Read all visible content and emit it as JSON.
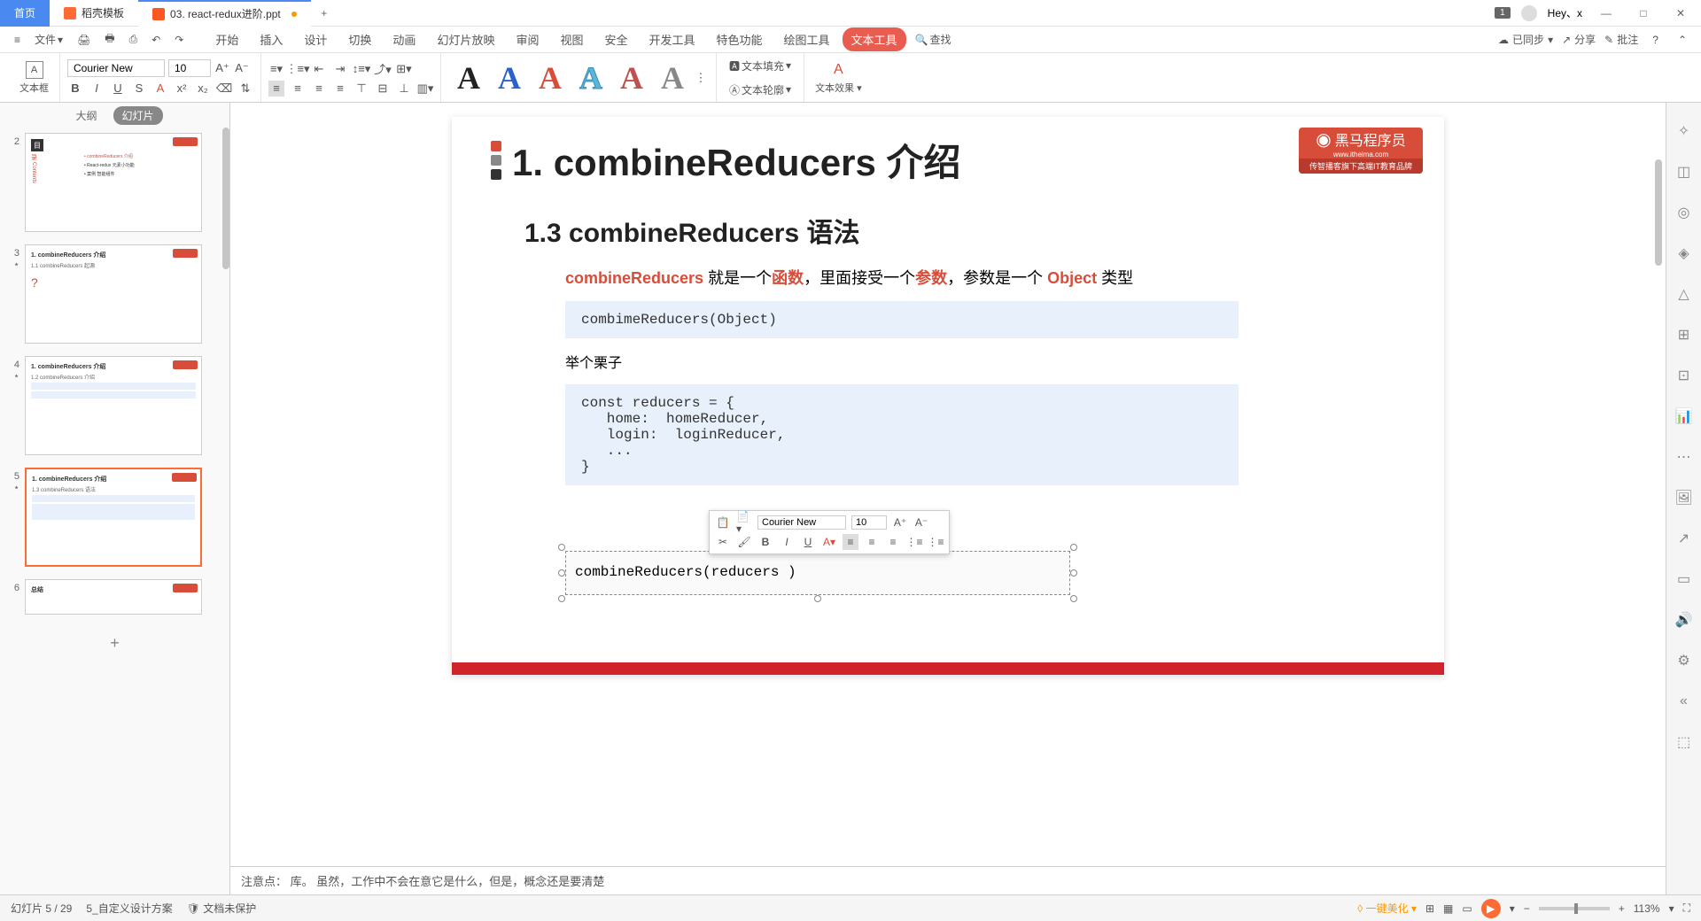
{
  "titlebar": {
    "home": "首页",
    "docer": "稻壳模板",
    "filename": "03. react-redux进阶.ppt",
    "badge": "1",
    "user": "Hey、x"
  },
  "menu": {
    "file": "文件",
    "tabs": [
      "开始",
      "插入",
      "设计",
      "切换",
      "动画",
      "幻灯片放映",
      "审阅",
      "视图",
      "安全",
      "开发工具",
      "特色功能",
      "绘图工具",
      "文本工具"
    ],
    "search": "查找",
    "sync": "已同步",
    "share": "分享",
    "comment": "批注"
  },
  "ribbon": {
    "textbox": "文本框",
    "font": "Courier New",
    "size": "10",
    "textFill": "文本填充",
    "textOutline": "文本轮廓",
    "textEffects": "文本效果"
  },
  "thumbs": {
    "outline": "大纲",
    "slides": "幻灯片",
    "items": [
      {
        "num": "2"
      },
      {
        "num": "3"
      },
      {
        "num": "4"
      },
      {
        "num": "5"
      },
      {
        "num": "6"
      }
    ]
  },
  "slide": {
    "h1": "1. combineReducers 介绍",
    "h2": "1.3 combineReducers 语法",
    "logo": "黑马程序员",
    "logo_url": "www.itheima.com",
    "logo_sub": "传智播客旗下高端IT教育品牌",
    "t1a": "combineReducers",
    "t1b": " 就是一个",
    "t1c": "函数",
    "t1d": "，里面接受一个",
    "t1e": "参数",
    "t1f": "，参数是一个 ",
    "t1g": "Object",
    "t1h": " 类型",
    "code1": "combimeReducers(Object)",
    "example": "举个栗子",
    "code2": "const reducers = {\n   home:  homeReducer,\n   login:  loginReducer,\n   ...\n}",
    "textbox": "combineReducers(reducers )"
  },
  "mini": {
    "font": "Courier New",
    "size": "10"
  },
  "notes": "注意点： 库。 虽然，工作中不会在意它是什么，但是，概念还是要清楚",
  "status": {
    "page": "幻灯片 5 / 29",
    "design": "5_自定义设计方案",
    "protect": "文档未保护",
    "beautify": "一键美化",
    "zoom": "113%"
  }
}
